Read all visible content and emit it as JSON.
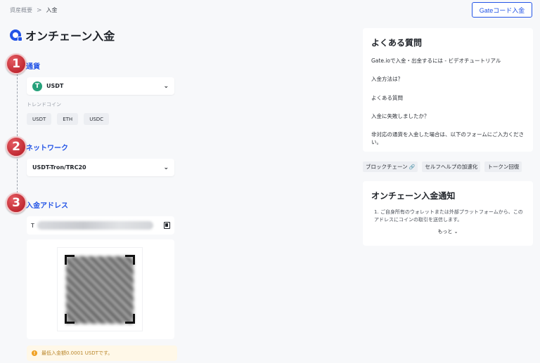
{
  "breadcrumb": {
    "parent": "資産概要",
    "separator": ">",
    "current": "入金"
  },
  "header": {
    "gate_code_button": "Gateコード入金",
    "title": "オンチェーン入金"
  },
  "steps": [
    {
      "number": "1",
      "label": "通貨"
    },
    {
      "number": "2",
      "label": "ネットワーク"
    },
    {
      "number": "3",
      "label": "入金アドレス"
    }
  ],
  "currency": {
    "selected": "USDT",
    "icon_letter": "T",
    "icon_color": "#26a17b"
  },
  "trend": {
    "label": "トレンドコイン",
    "coins": [
      "USDT",
      "ETH",
      "USDC"
    ]
  },
  "network": {
    "selected": "USDT-Tron/TRC20"
  },
  "address": {
    "prefix": "T"
  },
  "warning": {
    "text": "最低入金額0.0001 USDTです。"
  },
  "faq": {
    "title": "よくある質問",
    "items": [
      "Gate.ioで入金・出金するには - ビデオチュートリアル",
      "入金方法は？",
      "よくある質問",
      "入金に失敗しましたか？",
      "非対応の通貨を入金した場合は、以下のフォームにご入力ください。"
    ]
  },
  "tags": [
    "ブロックチェーン",
    "セルフヘルプの加速化",
    "トークン回復"
  ],
  "notice": {
    "title": "オンチェーン入金通知",
    "text": "1. ご自身所有のウォレットまたは外部プラットフォームから、このアドレスにコインの取引を送信します。",
    "more": "もっと"
  },
  "colors": {
    "accent": "#2354e6",
    "step_badge": "#c8222b"
  }
}
